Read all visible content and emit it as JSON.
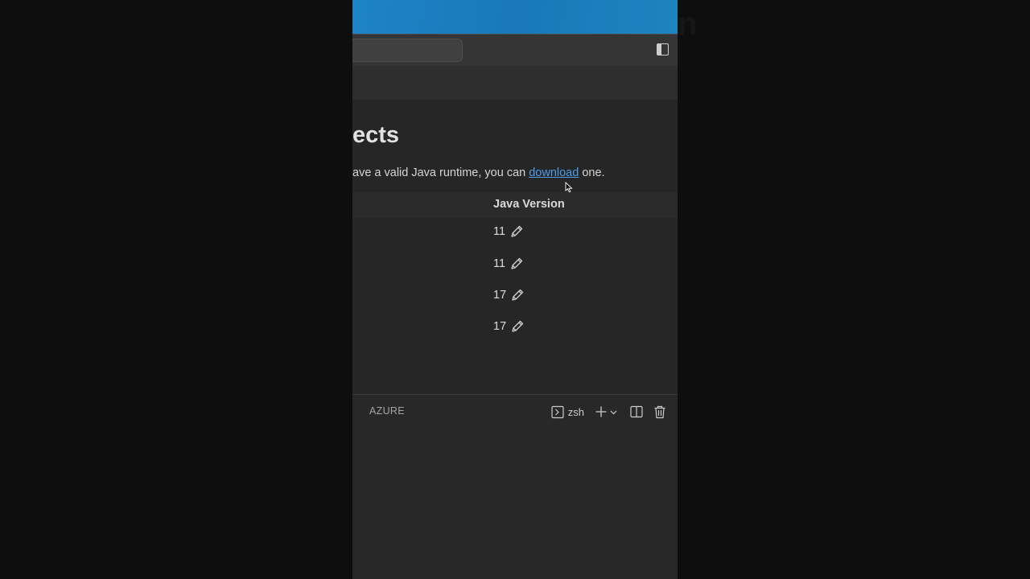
{
  "editor": {
    "title": "ects",
    "intro": {
      "before_link": "ave a valid Java runtime, you can ",
      "link": "download",
      "after_link": " one."
    },
    "table": {
      "column_java_version": "Java Version",
      "rows": [
        {
          "java_version": "11"
        },
        {
          "java_version": "11"
        },
        {
          "java_version": "17"
        },
        {
          "java_version": "17"
        }
      ]
    }
  },
  "panel": {
    "tab_label": "AZURE",
    "terminal_name": "zsh"
  },
  "colors": {
    "accent_link": "#4f9be8",
    "wallpaper": "#1a78b8",
    "background": "#262626"
  },
  "icons": {
    "toggle_sidebar": "toggle-sidebar-icon",
    "edit": "pencil-icon",
    "terminal": "terminal-icon",
    "add": "plus-icon",
    "dropdown": "chevron-down-icon",
    "split": "split-panel-icon",
    "trash": "trash-icon"
  }
}
